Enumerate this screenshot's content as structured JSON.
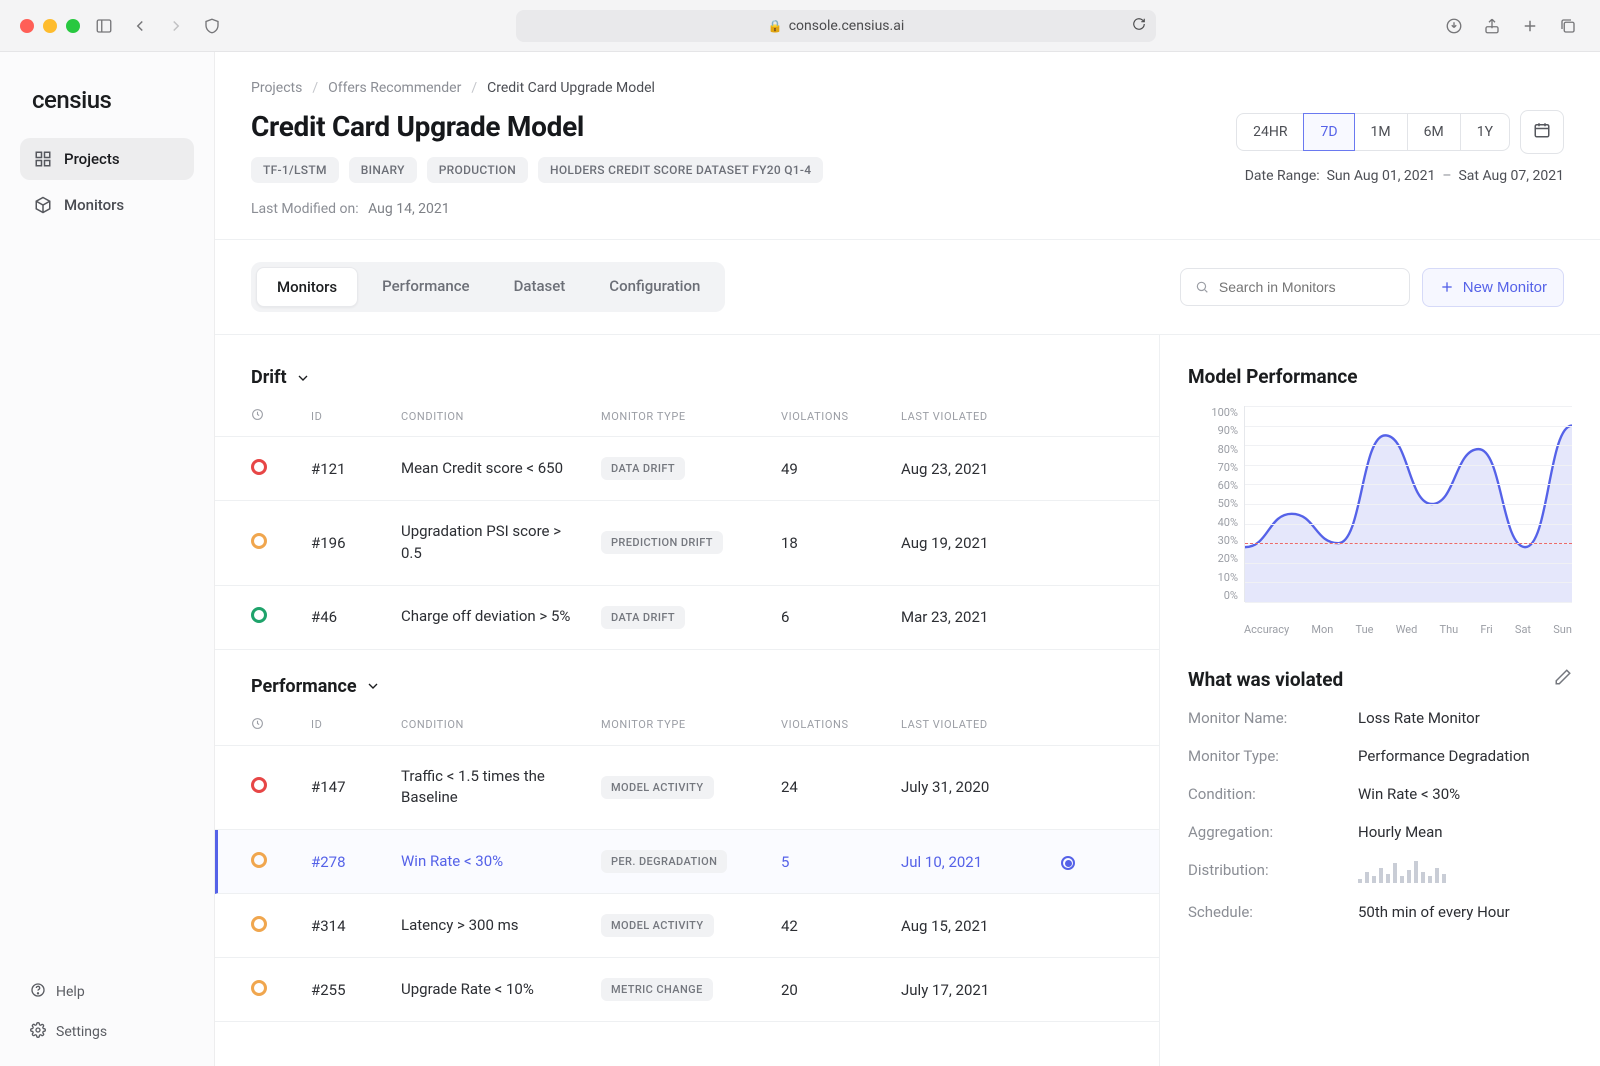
{
  "browser": {
    "url": "console.censius.ai"
  },
  "brand": "censius",
  "nav": {
    "projects": "Projects",
    "monitors": "Monitors"
  },
  "footer": {
    "help": "Help",
    "settings": "Settings"
  },
  "breadcrumb": {
    "root": "Projects",
    "project": "Offers Recommender",
    "model": "Credit Card Upgrade Model"
  },
  "page": {
    "title": "Credit Card Upgrade Model",
    "chips": [
      "TF-1/LSTM",
      "BINARY",
      "PRODUCTION",
      "HOLDERS CREDIT SCORE DATASET FY20 Q1-4"
    ],
    "last_label": "Last Modified on:",
    "last_value": "Aug 14, 2021"
  },
  "range": {
    "options": [
      "24HR",
      "7D",
      "1M",
      "6M",
      "1Y"
    ],
    "active": "7D",
    "label": "Date Range:",
    "from": "Sun Aug 01, 2021",
    "to": "Sat Aug 07, 2021"
  },
  "tabs": {
    "items": [
      "Monitors",
      "Performance",
      "Dataset",
      "Configuration"
    ],
    "active": "Monitors"
  },
  "search_placeholder": "Search in Monitors",
  "new_monitor_label": "New Monitor",
  "table": {
    "headers": {
      "status": "",
      "id": "ID",
      "condition": "CONDITION",
      "type": "MONITOR TYPE",
      "violations": "VIOLATIONS",
      "last": "LAST VIOLATED"
    }
  },
  "sections": {
    "drift": {
      "title": "Drift",
      "rows": [
        {
          "status": "red",
          "id": "#121",
          "condition": "Mean Credit score < 650",
          "type": "DATA DRIFT",
          "violations": "49",
          "last": "Aug 23, 2021"
        },
        {
          "status": "orange",
          "id": "#196",
          "condition": "Upgradation PSI score > 0.5",
          "type": "PREDICTION DRIFT",
          "violations": "18",
          "last": "Aug 19, 2021"
        },
        {
          "status": "green",
          "id": "#46",
          "condition": "Charge off deviation > 5%",
          "type": "DATA DRIFT",
          "violations": "6",
          "last": "Mar 23, 2021"
        }
      ]
    },
    "performance": {
      "title": "Performance",
      "rows": [
        {
          "status": "red",
          "id": "#147",
          "condition": "Traffic < 1.5 times the Baseline",
          "type": "MODEL ACTIVITY",
          "violations": "24",
          "last": "July 31, 2020",
          "selected": false
        },
        {
          "status": "orange",
          "id": "#278",
          "condition": "Win Rate < 30%",
          "type": "PER. DEGRADATION",
          "violations": "5",
          "last": "Jul 10, 2021",
          "selected": true
        },
        {
          "status": "orange",
          "id": "#314",
          "condition": "Latency > 300 ms",
          "type": "MODEL ACTIVITY",
          "violations": "42",
          "last": "Aug 15, 2021",
          "selected": false
        },
        {
          "status": "orange",
          "id": "#255",
          "condition": "Upgrade Rate < 10%",
          "type": "METRIC CHANGE",
          "violations": "20",
          "last": "July 17, 2021",
          "selected": false
        }
      ]
    }
  },
  "right": {
    "perf_title": "Model Performance",
    "what_title": "What was violated",
    "kv": {
      "monitor_name_k": "Monitor Name:",
      "monitor_name_v": "Loss Rate Monitor",
      "monitor_type_k": "Monitor Type:",
      "monitor_type_v": "Performance Degradation",
      "condition_k": "Condition:",
      "condition_v": "Win Rate < 30%",
      "aggregation_k": "Aggregation:",
      "aggregation_v": "Hourly Mean",
      "distribution_k": "Distribution:",
      "schedule_k": "Schedule:",
      "schedule_v": "50th min of every Hour"
    }
  },
  "chart_data": {
    "type": "area",
    "title": "Model Performance",
    "xlabel": "",
    "ylabel": "",
    "ylim": [
      0,
      100
    ],
    "yticks": [
      "100%",
      "90%",
      "80%",
      "70%",
      "60%",
      "50%",
      "40%",
      "30%",
      "20%",
      "10%",
      "0%"
    ],
    "threshold": 30,
    "categories": [
      "Accuracy",
      "Mon",
      "Tue",
      "Wed",
      "Thu",
      "Fri",
      "Sat",
      "Sun"
    ],
    "values": [
      28,
      45,
      30,
      85,
      50,
      78,
      28,
      90
    ]
  },
  "distribution_spark": [
    4,
    10,
    6,
    14,
    8,
    18,
    6,
    12,
    20,
    10,
    6,
    14,
    8
  ]
}
